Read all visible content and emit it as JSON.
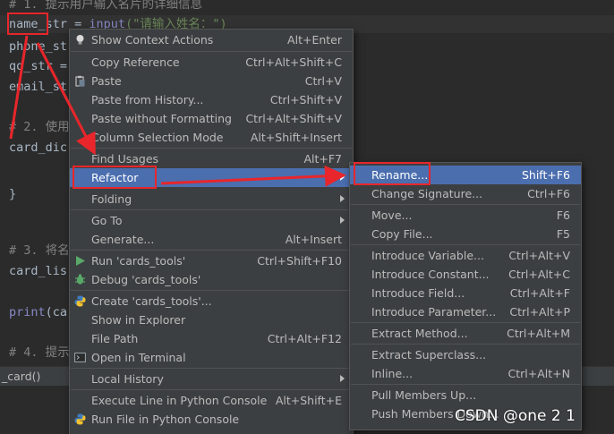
{
  "editor": {
    "lines": {
      "l0": "# 1. 提示用户输入名片的详细信息",
      "l1_var": "name_str",
      "l1_eq": " = ",
      "l1_fn": "input",
      "l1_str": "(\"请输入姓名：\")",
      "l2": "phone_st",
      "l3": "qq_str =",
      "l4": "email_st",
      "l5": "# 2. 使用",
      "l6": "card_dic",
      "l7": "}",
      "l8": "# 3. 将名",
      "l9": "card_lis",
      "l10_fn": "print",
      "l10_rest": "(ca",
      "l11": "# 4. 提示"
    },
    "breadcrumb": "_card()"
  },
  "context_menu": {
    "items": [
      {
        "label": "Show Context Actions",
        "shortcut": "Alt+Enter",
        "icon": "bulb-icon"
      },
      {
        "label": "Copy Reference",
        "shortcut": "Ctrl+Alt+Shift+C"
      },
      {
        "label": "Paste",
        "shortcut": "Ctrl+V",
        "icon": "paste-icon"
      },
      {
        "label": "Paste from History...",
        "shortcut": "Ctrl+Shift+V"
      },
      {
        "label": "Paste without Formatting",
        "shortcut": "Ctrl+Alt+Shift+V"
      },
      {
        "label": "Column Selection Mode",
        "shortcut": "Alt+Shift+Insert"
      },
      {
        "label": "Find Usages",
        "shortcut": "Alt+F7"
      },
      {
        "label": "Refactor",
        "shortcut": ""
      },
      {
        "label": "Folding",
        "shortcut": ""
      },
      {
        "label": "Go To",
        "shortcut": ""
      },
      {
        "label": "Generate...",
        "shortcut": "Alt+Insert"
      },
      {
        "label": "Run 'cards_tools'",
        "shortcut": "Ctrl+Shift+F10",
        "icon": "run-icon"
      },
      {
        "label": "Debug 'cards_tools'",
        "shortcut": "",
        "icon": "debug-icon"
      },
      {
        "label": "Create 'cards_tools'...",
        "shortcut": "",
        "icon": "python-icon"
      },
      {
        "label": "Show in Explorer",
        "shortcut": ""
      },
      {
        "label": "File Path",
        "shortcut": "Ctrl+Alt+F12"
      },
      {
        "label": "Open in Terminal",
        "shortcut": "",
        "icon": "terminal-icon"
      },
      {
        "label": "Local History",
        "shortcut": ""
      },
      {
        "label": "Execute Line in Python Console",
        "shortcut": "Alt+Shift+E"
      },
      {
        "label": "Run File in Python Console",
        "shortcut": "",
        "icon": "python-icon"
      }
    ]
  },
  "refactor_menu": {
    "items": [
      {
        "label": "Rename...",
        "shortcut": "Shift+F6"
      },
      {
        "label": "Change Signature...",
        "shortcut": "Ctrl+F6"
      },
      {
        "label": "Move...",
        "shortcut": "F6"
      },
      {
        "label": "Copy File...",
        "shortcut": "F5"
      },
      {
        "label": "Introduce Variable...",
        "shortcut": "Ctrl+Alt+V"
      },
      {
        "label": "Introduce Constant...",
        "shortcut": "Ctrl+Alt+C"
      },
      {
        "label": "Introduce Field...",
        "shortcut": "Ctrl+Alt+F"
      },
      {
        "label": "Introduce Parameter...",
        "shortcut": "Ctrl+Alt+P"
      },
      {
        "label": "Extract Method...",
        "shortcut": "Ctrl+Alt+M"
      },
      {
        "label": "Extract Superclass...",
        "shortcut": ""
      },
      {
        "label": "Inline...",
        "shortcut": "Ctrl+Alt+N"
      },
      {
        "label": "Pull Members Up...",
        "shortcut": ""
      },
      {
        "label": "Push Members Down...",
        "shortcut": ""
      }
    ]
  },
  "watermark": "CSDN @one 2 1",
  "colors": {
    "menu_bg": "#3c3f41",
    "selection": "#4b6eaf",
    "annotation": "#e8262b",
    "editor_bg": "#2b2b2b"
  }
}
